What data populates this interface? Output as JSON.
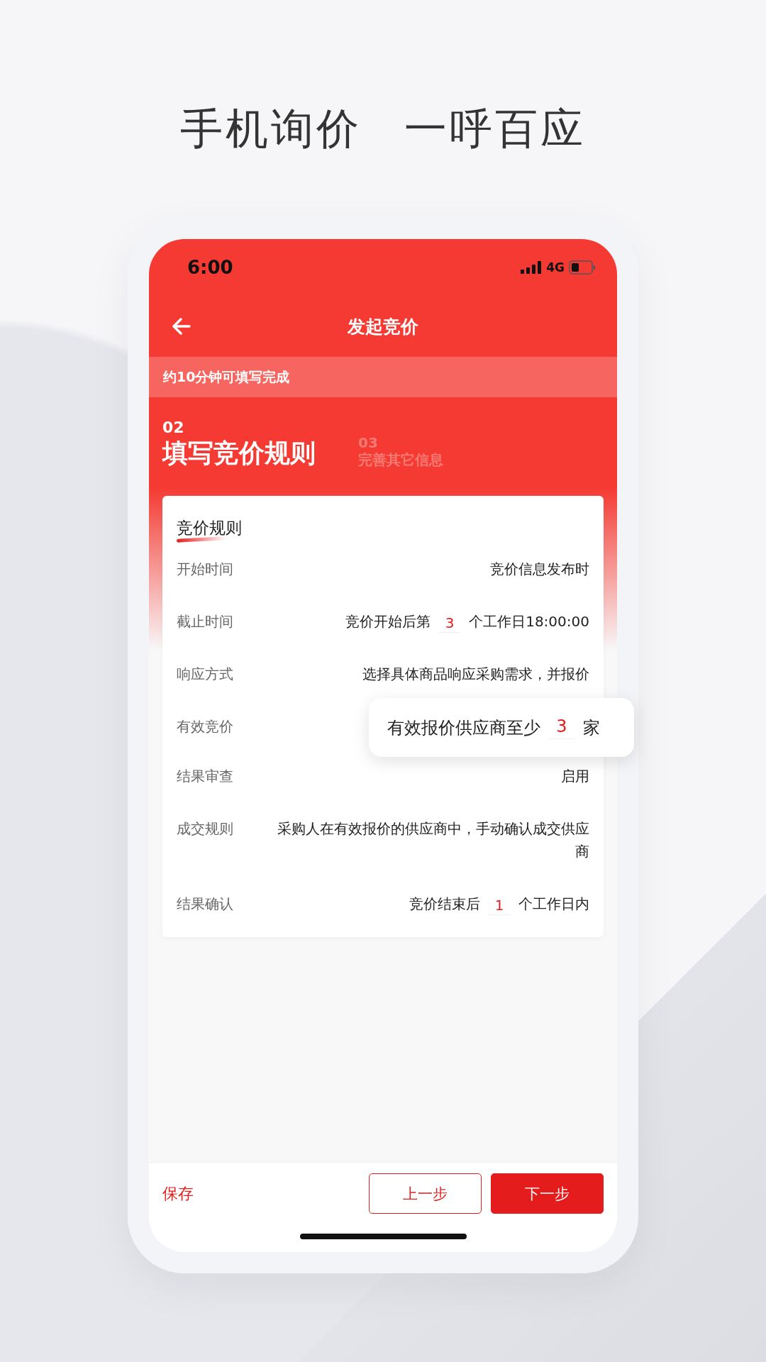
{
  "headline": [
    "手机询价",
    "一呼百应"
  ],
  "status_bar": {
    "time": "6:00",
    "network": "4G"
  },
  "nav": {
    "title": "发起竞价"
  },
  "banner": "约10分钟可填写完成",
  "steps": [
    {
      "number": "02",
      "label": "填写竞价规则",
      "selected": true
    },
    {
      "number": "03",
      "label": "完善其它信息",
      "selected": false
    }
  ],
  "card": {
    "title": "竞价规则",
    "rows": [
      {
        "label": "开始时间",
        "segments": [
          {
            "kind": "text",
            "text": "竞价信息发布时"
          }
        ]
      },
      {
        "label": "截止时间",
        "segments": [
          {
            "kind": "text",
            "text": "竞价开始后第"
          },
          {
            "kind": "input",
            "text": "3"
          },
          {
            "kind": "text",
            "text": "个工作日18:00:00"
          }
        ]
      },
      {
        "label": "响应方式",
        "segments": [
          {
            "kind": "text",
            "text": "选择具体商品响应采购需求，并报价"
          }
        ]
      },
      {
        "label": "有效竞价",
        "popup": [
          {
            "kind": "text",
            "text": "有效报价供应商至少"
          },
          {
            "kind": "input",
            "text": "3"
          },
          {
            "kind": "text",
            "text": "家"
          }
        ]
      },
      {
        "label": "结果审查",
        "segments": [
          {
            "kind": "text",
            "text": "启用"
          }
        ]
      },
      {
        "label": "成交规则",
        "segments": [
          {
            "kind": "text",
            "text": "采购人在有效报价的供应商中，手动确认成交供应商"
          }
        ]
      },
      {
        "label": "结果确认",
        "segments": [
          {
            "kind": "text",
            "text": "竞价结束后"
          },
          {
            "kind": "input",
            "text": "1"
          },
          {
            "kind": "text",
            "text": "个工作日内"
          }
        ]
      }
    ]
  },
  "footer": {
    "save": "保存",
    "prev": "上一步",
    "next": "下一步"
  }
}
